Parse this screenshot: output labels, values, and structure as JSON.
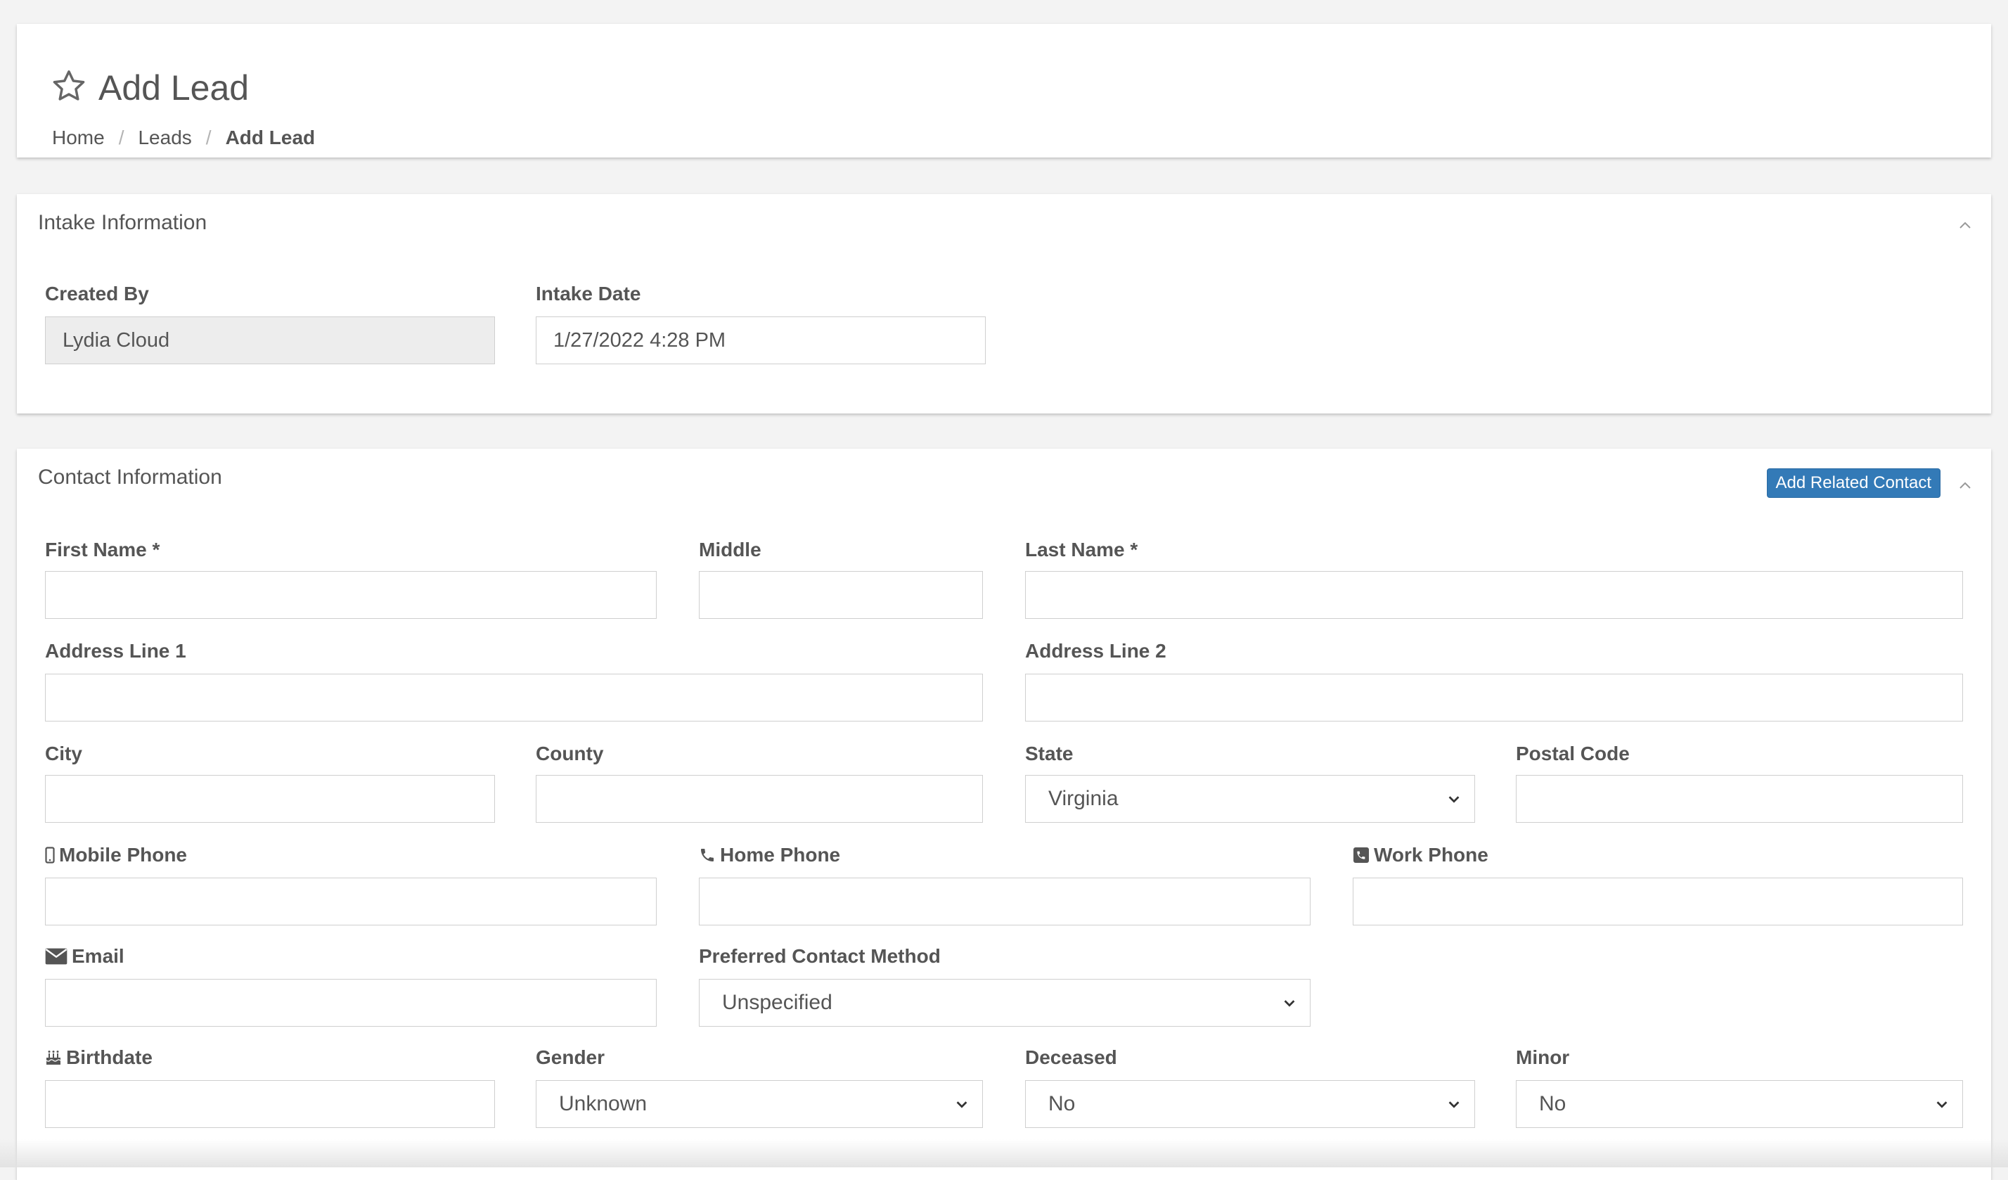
{
  "header": {
    "title": "Add Lead",
    "icon": "star-icon",
    "breadcrumb": [
      "Home",
      "Leads",
      "Add Lead"
    ],
    "separator": "/"
  },
  "intake": {
    "title": "Intake Information",
    "created_by_label": "Created By",
    "created_by_value": "Lydia Cloud",
    "intake_date_label": "Intake Date",
    "intake_date_value": "1/27/2022 4:28 PM"
  },
  "contact": {
    "title": "Contact Information",
    "add_related_label": "Add Related Contact",
    "accent_color": "#337ab7",
    "labels": {
      "first_name": "First Name *",
      "middle": "Middle",
      "last_name": "Last Name *",
      "address1": "Address Line 1",
      "address2": "Address Line 2",
      "city": "City",
      "county": "County",
      "state": "State",
      "postal_code": "Postal Code",
      "mobile_phone": "Mobile Phone",
      "home_phone": "Home Phone",
      "work_phone": "Work Phone",
      "email": "Email",
      "preferred_contact": "Preferred Contact Method",
      "birthdate": "Birthdate",
      "gender": "Gender",
      "deceased": "Deceased",
      "minor": "Minor"
    },
    "values": {
      "first_name": "",
      "middle": "",
      "last_name": "",
      "address1": "",
      "address2": "",
      "city": "",
      "county": "",
      "state": "Virginia",
      "postal_code": "",
      "mobile_phone": "",
      "home_phone": "",
      "work_phone": "",
      "email": "",
      "preferred_contact": "Unspecified",
      "birthdate": "",
      "gender": "Unknown",
      "deceased": "No",
      "minor": "No"
    },
    "icons": {
      "mobile_phone": "mobile-phone-icon",
      "home_phone": "phone-icon",
      "work_phone": "phone-square-icon",
      "email": "envelope-icon",
      "birthdate": "birthday-cake-icon"
    }
  }
}
